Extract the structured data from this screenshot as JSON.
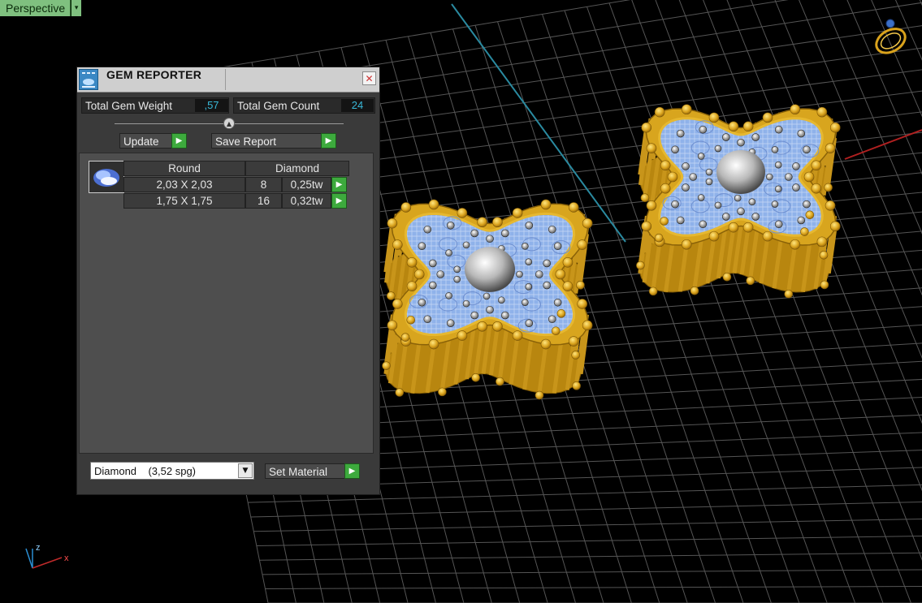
{
  "viewport": {
    "label": "Perspective",
    "menu_arrow": "▾",
    "axis": {
      "z": "z",
      "x": "x"
    },
    "colors": {
      "grid": "#555555",
      "y_axis": "#2a8aa0",
      "x_axis": "#b02020",
      "gold": "#d8a51e",
      "blue_gem": "#8fb2ea"
    }
  },
  "gem_reporter": {
    "title": "GEM REPORTER",
    "close_icon": "✕",
    "total_weight_label": "Total Gem Weight",
    "total_weight_value": ",57",
    "total_count_label": "Total Gem Count",
    "total_count_value": "24",
    "update_label": "Update",
    "save_report_label": "Save Report",
    "go_glyph": "▶",
    "table": {
      "headers": [
        "Round",
        "Diamond"
      ],
      "rows": [
        {
          "size": "2,03 X 2,03",
          "count": "8",
          "weight": "0,25tw"
        },
        {
          "size": "1,75 X 1,75",
          "count": "16",
          "weight": "0,32tw"
        }
      ]
    },
    "material_select": "Diamond    (3,52 spg)",
    "set_material_label": "Set Material"
  }
}
